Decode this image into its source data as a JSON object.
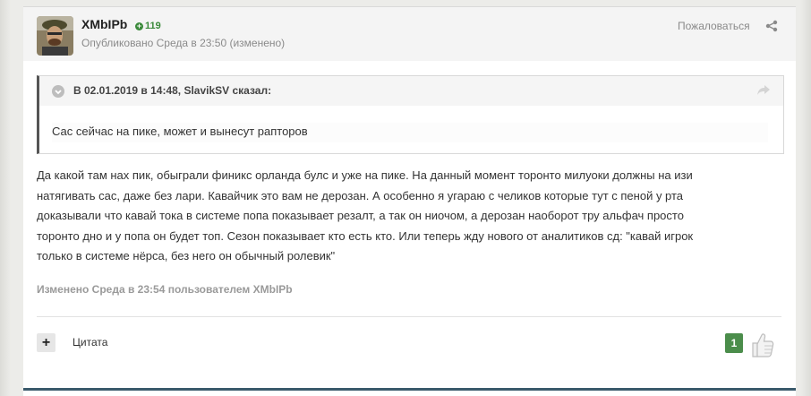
{
  "post": {
    "author": "XMbIPb",
    "reputation": "119",
    "meta": "Опубликовано Среда в 23:50 (изменено)",
    "report_label": "Пожаловаться",
    "quote": {
      "citation": "В 02.01.2019 в 14:48, SlavikSV сказал:",
      "text": "Сас сейчас на пике, может и вынесут рапторов"
    },
    "content_lines": [
      "Да какой там нах пик, обыграли финикс орланда булс и уже на пике. На данный момент торонто милуоки  должны на изи",
      "натягивать сас, даже без лари. Кавайчик это вам не дерозан. А особенно я угараю с челиков которые тут с пеной у рта",
      "доказывали что кавай тока в системе попа показывает резалт, а так он ниочом, а дерозан наоборот тру альфач просто",
      "торонто дно и у попа он будет топ.  Сезон показывает  кто есть кто. Или теперь жду нового от аналитиков сд: \"кавай игрок",
      "только в системе нёрса, без него он обычный ролевик\""
    ],
    "edited": "Изменено Среда в 23:54 пользователем XMbIPb",
    "footer": {
      "plus_label": "+",
      "quote_label": "Цитата",
      "like_count": "1"
    }
  },
  "colors": {
    "reputation": "#3b8a3b",
    "like_badge": "#4b8d4b",
    "bottom_accent": "#3a5a6b"
  },
  "icons": [
    "avatar",
    "share-icon",
    "chevron-down-icon",
    "reply-share-icon",
    "thumbs-up-icon"
  ]
}
